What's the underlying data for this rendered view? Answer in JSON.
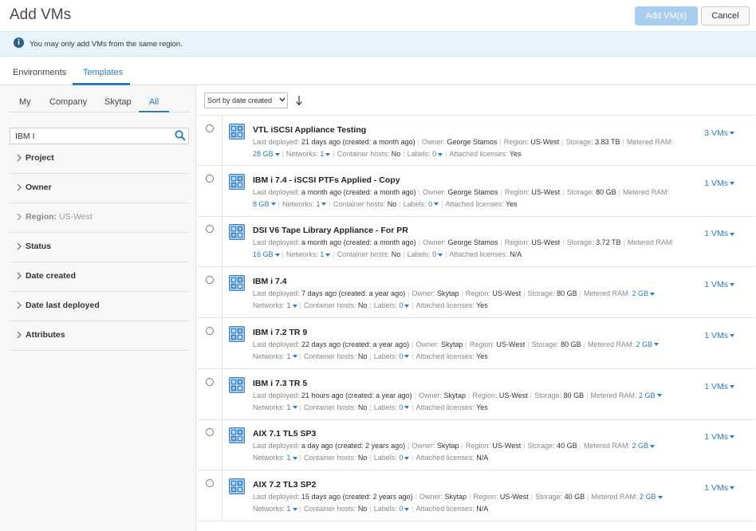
{
  "window": {
    "title": "Add VMs",
    "add_button": "Add VM(s)",
    "cancel_button": "Cancel"
  },
  "banner": {
    "text": "You may only add VMs from the same region."
  },
  "tabs": [
    {
      "label": "Environments"
    },
    {
      "label": "Templates"
    }
  ],
  "filter_tabs": [
    {
      "label": "My"
    },
    {
      "label": "Company"
    },
    {
      "label": "Skytap"
    },
    {
      "label": "All"
    }
  ],
  "search": {
    "value": "IBM I"
  },
  "filters": [
    {
      "label": "Project"
    },
    {
      "label": "Owner"
    },
    {
      "label": "Region:",
      "value": "US-West"
    },
    {
      "label": "Status"
    },
    {
      "label": "Date created"
    },
    {
      "label": "Date last deployed"
    },
    {
      "label": "Attributes"
    }
  ],
  "sort": {
    "selected": "Sort by date created"
  },
  "labels": {
    "last_deployed": "Last deployed:",
    "owner": "Owner:",
    "region": "Region:",
    "storage": "Storage:",
    "metered_ram": "Metered RAM:",
    "networks": "Networks:",
    "container_hosts": "Container hosts:",
    "labels": "Labels:",
    "attached_licenses": "Attached licenses:"
  },
  "templates": [
    {
      "name": "VTL iSCSI Appliance Testing",
      "last_deployed": "21 days ago (created: a month ago)",
      "owner": "George Stamos",
      "region": "US-West",
      "storage": "3.83 TB",
      "ram": "28 GB",
      "networks": "1",
      "container_hosts": "No",
      "labels": "0",
      "licenses": "Yes",
      "vms": "3 VMs"
    },
    {
      "name": "IBM i 7.4 - iSCSI PTFs Applied - Copy",
      "last_deployed": "a month ago (created: a month ago)",
      "owner": "George Stamos",
      "region": "US-West",
      "storage": "80 GB",
      "ram": "8 GB",
      "networks": "1",
      "container_hosts": "No",
      "labels": "0",
      "licenses": "Yes",
      "vms": "1 VMs"
    },
    {
      "name": "DSI V6 Tape Library Appliance - For PR",
      "last_deployed": "a month ago (created: a month ago)",
      "owner": "George Stamos",
      "region": "US-West",
      "storage": "3.72 TB",
      "ram": "16 GB",
      "networks": "1",
      "container_hosts": "No",
      "labels": "0",
      "licenses": "N/A",
      "vms": "1 VMs"
    },
    {
      "name": "IBM i 7.4",
      "last_deployed": "7 days ago (created: a year ago)",
      "owner": "Skytap",
      "region": "US-West",
      "storage": "80 GB",
      "ram": "2 GB",
      "networks": "1",
      "container_hosts": "No",
      "labels": "0",
      "licenses": "Yes",
      "vms": "1 VMs"
    },
    {
      "name": "IBM i 7.2 TR 9",
      "last_deployed": "22 days ago (created: a year ago)",
      "owner": "Skytap",
      "region": "US-West",
      "storage": "80 GB",
      "ram": "2 GB",
      "networks": "1",
      "container_hosts": "No",
      "labels": "0",
      "licenses": "Yes",
      "vms": "1 VMs"
    },
    {
      "name": "IBM i 7.3 TR 5",
      "last_deployed": "21 hours ago (created: a year ago)",
      "owner": "Skytap",
      "region": "US-West",
      "storage": "80 GB",
      "ram": "2 GB",
      "networks": "1",
      "container_hosts": "No",
      "labels": "0",
      "licenses": "Yes",
      "vms": "1 VMs"
    },
    {
      "name": "AIX 7.1 TL5 SP3",
      "last_deployed": "a day ago (created: 2 years ago)",
      "owner": "Skytap",
      "region": "US-West",
      "storage": "40 GB",
      "ram": "2 GB",
      "networks": "1",
      "container_hosts": "No",
      "labels": "0",
      "licenses": "N/A",
      "vms": "1 VMs"
    },
    {
      "name": "AIX 7.2 TL3 SP2",
      "last_deployed": "15 days ago (created: 2 years ago)",
      "owner": "Skytap",
      "region": "US-West",
      "storage": "40 GB",
      "ram": "2 GB",
      "networks": "1",
      "container_hosts": "No",
      "labels": "0",
      "licenses": "N/A",
      "vms": "1 VMs"
    }
  ],
  "colors": {
    "accent": "#2a7bbf",
    "disabled_button": "#a9cdee",
    "banner_bg": "#e8f4fb"
  },
  "icons": {
    "info": "info-icon",
    "search": "search-icon",
    "template": "template-icon",
    "sort_direction": "arrow-down-icon"
  }
}
